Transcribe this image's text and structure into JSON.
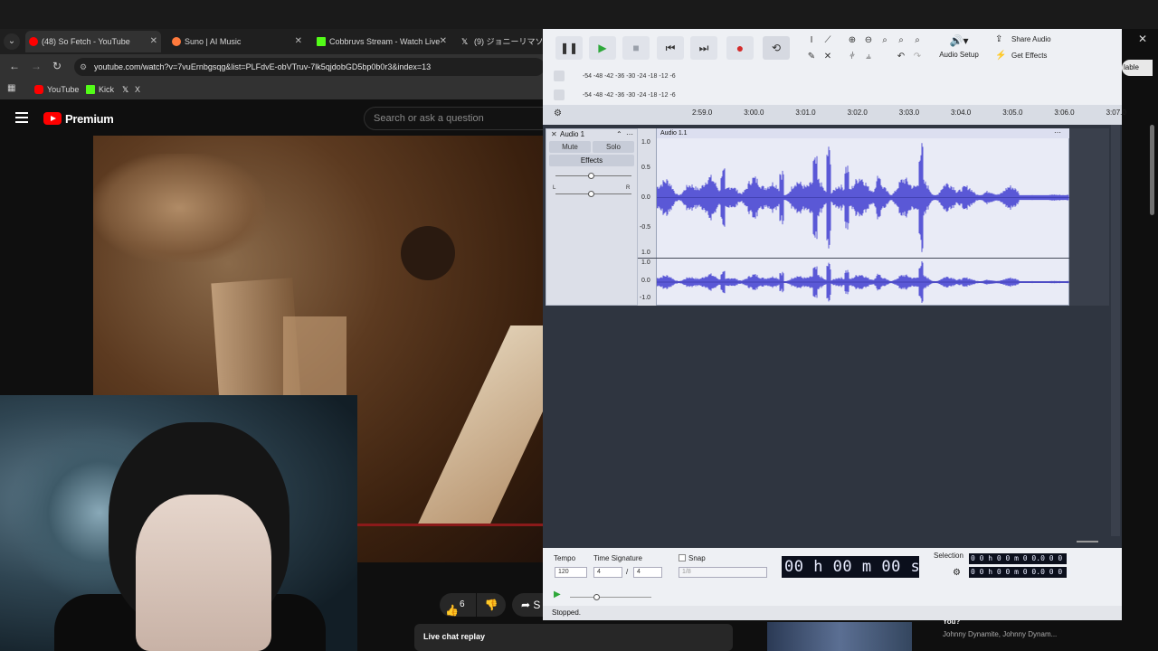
{
  "browser": {
    "tabs": [
      {
        "title": "(48) So Fetch - YouTube",
        "fav": "#ff0000"
      },
      {
        "title": "Suno | AI Music",
        "fav": "#ff7a3c"
      },
      {
        "title": "Cobbruvs Stream - Watch Live",
        "fav": "#53fc18"
      },
      {
        "title": "(9) ジョニーリマソ | 途都",
        "fav": "#ffffff"
      }
    ],
    "url": "youtube.com/watch?v=7vuErnbgsqg&list=PLFdvE-obVTruv-7lk5qjdobGD5bp0b0r3&index=13",
    "bookmarks": [
      "YouTube",
      "Kick",
      "X"
    ]
  },
  "youtube": {
    "brand": "Premium",
    "search_placeholder": "Search or ask a question",
    "like_count": "6",
    "share_label": "S",
    "live_chat_replay": "Live chat replay",
    "subscribe_partial": "lable",
    "rec_title": "You?",
    "rec_meta": "Johnny Dynamite, Johnny Dynam..."
  },
  "audacity": {
    "audio_setup": "Audio Setup",
    "share_audio": "Share Audio",
    "get_effects": "Get Effects",
    "meter_scale": "-54 -48 -42 -36 -30 -24 -18 -12 -6",
    "ruler_ticks": [
      "2:59.0",
      "3:00.0",
      "3:01.0",
      "3:02.0",
      "3:03.0",
      "3:04.0",
      "3:05.0",
      "3:06.0",
      "3:07.0"
    ],
    "track": {
      "name": "Audio 1",
      "clip_name": "Audio 1.1",
      "mute": "Mute",
      "solo": "Solo",
      "effects": "Effects",
      "pan_left": "L",
      "pan_right": "R"
    },
    "scale_top": [
      "1.0",
      "0.5",
      "0.0",
      "-0.5"
    ],
    "scale_bottom": [
      "1.0",
      "1.0",
      "0.0",
      "-1.0"
    ],
    "tempo_label": "Tempo",
    "tempo_value": "120",
    "time_sig_label": "Time Signature",
    "time_sig_num": "4",
    "time_sig_slash": "/",
    "time_sig_den": "4",
    "snap_label": "Snap",
    "snap_value": "1/8",
    "time_display": "00 h 00 m 00 s",
    "selection_label": "Selection",
    "selection_start": "0 0 h 0 0 m 0 0.0 0 0 s",
    "selection_end": "0 0 h 0 0 m 0 0.0 0 0 s",
    "status": "Stopped.",
    "colors": {
      "waveform": "#5a58d6",
      "wave_bg": "#e9ebf6"
    }
  }
}
